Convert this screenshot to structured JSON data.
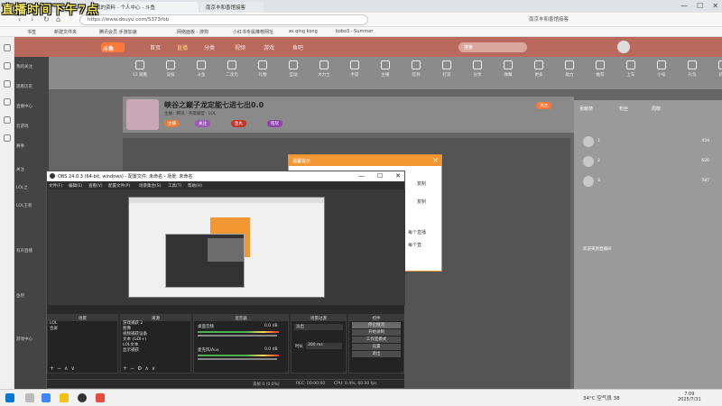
{
  "overlay": {
    "title": "直播时间下午7点"
  },
  "browser": {
    "tabs": [
      {
        "label": "我的资料 - 个人中心 - 斗鱼"
      },
      {
        "label": "南京丰和香馆接客"
      }
    ],
    "url": "https://www.douyu.com/5373rbb",
    "url_prefix": "",
    "search_hint": "南京丰和香馆接客",
    "window_controls": [
      "—",
      "☐",
      "✕"
    ],
    "bookmarks": [
      "书签",
      "新建文件夹",
      "腾讯会员 手游加速",
      "网络面板 - 搜狗",
      "小红书专属推荐网址",
      "xs qing kong",
      "kobo3 - Summer"
    ]
  },
  "douyu": {
    "logo": "斗鱼",
    "nav": [
      "首页",
      "直播",
      "分类",
      "视频",
      "游戏",
      "鱼吧"
    ],
    "nav_active": "直播",
    "search_placeholder": "搜索",
    "left_menu": [
      "我的关注",
      "观看历史",
      "直播中心",
      "云游戏",
      "赛事",
      "关注",
      "LOL之",
      "LOL王者",
      "有声直播",
      "鱼吧",
      "游戏中心"
    ],
    "categories": [
      "12 观看",
      "竞技",
      "斗鱼",
      "二次元",
      "礼物",
      "互动",
      "大力士",
      "手游",
      "主播",
      "签到",
      "打赏",
      "分享",
      "弹幕",
      "更多",
      "助力",
      "推荐",
      "上车",
      "小号",
      "礼包",
      "新星",
      "荣耀"
    ],
    "room_title": "峡谷之巅子龙定能七进七出0.0",
    "room_meta": "主播：腾讯 · 英雄联盟 · LOL",
    "room_tags": [
      "主播",
      "关注",
      "鱼丸",
      "陪玩"
    ],
    "follow_btn": "关注",
    "chat": {
      "tabs": [
        "贡献榜",
        "粉丝",
        "周榜"
      ],
      "ranks": [
        {
          "name": "1",
          "score": "459"
        },
        {
          "name": "2",
          "score": "626"
        },
        {
          "name": "3",
          "score": "587"
        }
      ],
      "welcome": "欢迎来到直播间"
    }
  },
  "modal": {
    "title": "温馨提示",
    "rows": [
      "复制",
      "复制",
      "每个直播",
      "每个直"
    ]
  },
  "obs": {
    "title": "OBS 24.0.3 (64-bit, windows) - 配置文件: 未命名 - 场景: 未命名",
    "menus": [
      "文件(F)",
      "编辑(E)",
      "查看(V)",
      "配置文件(P)",
      "场景集合(S)",
      "工具(T)",
      "帮助(H)"
    ],
    "docks": {
      "scenes": {
        "title": "场景",
        "items": [
          "LOL",
          "合屏"
        ]
      },
      "sources": {
        "title": "来源",
        "items": [
          "游戏捕获 2",
          "图像",
          "视频捕获设备",
          "文本 (GDI+)",
          "LOL文本",
          "显示捕获"
        ]
      },
      "mixer": {
        "title": "混音器",
        "channels": [
          {
            "name": "桌面音频",
            "db": "0.0 dB"
          },
          {
            "name": "麦克风/Aux",
            "db": "0.0 dB"
          }
        ]
      },
      "transitions": {
        "title": "场景过渡",
        "type": "淡出",
        "duration_label": "时长",
        "duration": "300 ms"
      },
      "controls": {
        "title": "控件",
        "buttons": [
          "停止推流",
          "开始录制",
          "工作室模式",
          "设置",
          "退出"
        ]
      }
    },
    "status": {
      "live": "LIVE: 00:00:00",
      "rec": "REC: 00:00:00",
      "cpu": "CPU: 0.4%, 60.00 fps",
      "dropped": "丢帧 0 (0.0%)"
    }
  },
  "taskbar": {
    "weather": "34°C 空气良 38",
    "time": "7:09",
    "date": "2025/7/31"
  },
  "colors": {
    "douyu_header": "#b96a5c",
    "douyu_accent": "#ff7a3a",
    "modal_header": "#f39733"
  }
}
